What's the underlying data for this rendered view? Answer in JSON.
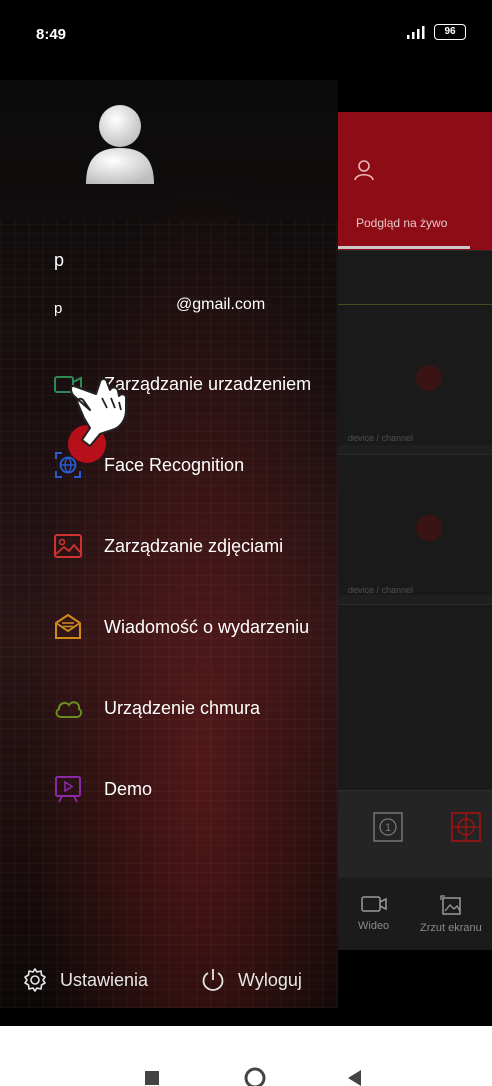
{
  "status_bar": {
    "time": "8:49",
    "battery": "96"
  },
  "drawer": {
    "user_name": "p",
    "email_prefix": "p",
    "email": "@gmail.com",
    "menu": [
      {
        "label": "Zarządzanie urzadzeniem",
        "icon": "camera-icon",
        "color": "#2e8b57"
      },
      {
        "label": "Face Recognition",
        "icon": "face-recognition-icon",
        "color": "#2a5bd7"
      },
      {
        "label": "Zarządzanie zdjęciami",
        "icon": "image-icon",
        "color": "#d0322f"
      },
      {
        "label": "Wiadomość o wydarzeniu",
        "icon": "event-message-icon",
        "color": "#d08a1c"
      },
      {
        "label": "Urządzenie chmura",
        "icon": "cloud-icon",
        "color": "#6a8f1e"
      },
      {
        "label": "Demo",
        "icon": "demo-play-icon",
        "color": "#8a2aa8"
      }
    ],
    "settings_label": "Ustawienia",
    "logout_label": "Wyloguj"
  },
  "background_app": {
    "tab_label": "Podgląd na żywo",
    "cell_label_1": "device / channel",
    "cell_label_2": "device / channel",
    "nav_video": "Wideo",
    "nav_screenshot": "Zrzut ekranu",
    "accent": "#8e0c16"
  }
}
